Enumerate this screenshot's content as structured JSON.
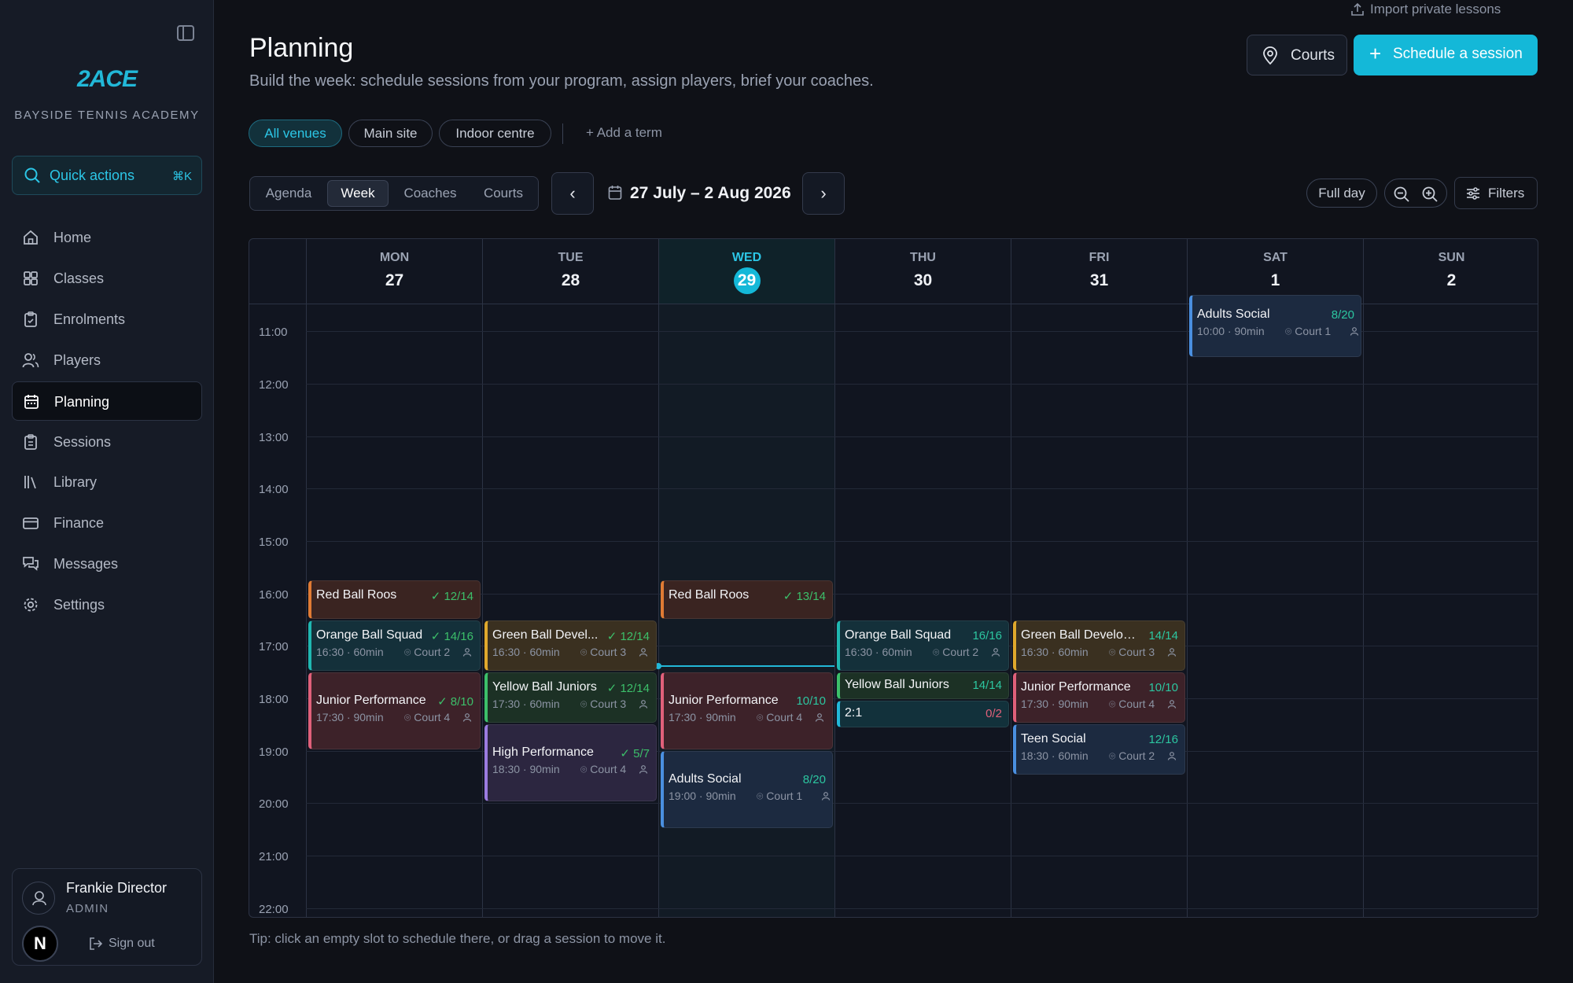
{
  "sidebar": {
    "logo": "2ACE",
    "academy": "BAYSIDE TENNIS ACADEMY",
    "quick_actions": {
      "label": "Quick actions",
      "shortcut": "⌘K"
    },
    "items": [
      {
        "label": "Home",
        "icon": "home-icon"
      },
      {
        "label": "Classes",
        "icon": "grid-icon"
      },
      {
        "label": "Enrolments",
        "icon": "clipboard-icon"
      },
      {
        "label": "Players",
        "icon": "users-icon"
      },
      {
        "label": "Planning",
        "icon": "calendar-icon",
        "active": true
      },
      {
        "label": "Sessions",
        "icon": "clipboard-list-icon"
      },
      {
        "label": "Library",
        "icon": "library-icon"
      },
      {
        "label": "Finance",
        "icon": "card-icon"
      },
      {
        "label": "Messages",
        "icon": "messages-icon"
      },
      {
        "label": "Settings",
        "icon": "gear-icon"
      }
    ],
    "user": {
      "name": "Frankie Director",
      "role": "ADMIN",
      "badge": "N",
      "signout": "Sign out"
    }
  },
  "header": {
    "import_label": "Import private lessons",
    "title": "Planning",
    "subtitle": "Build the week: schedule sessions from your program, assign players, brief your coaches.",
    "courts_label": "Courts",
    "schedule_label": "Schedule a session"
  },
  "venues": {
    "chips": [
      "All venues",
      "Main site",
      "Indoor centre"
    ],
    "active": "All venues",
    "add_term": "Add a term"
  },
  "toolbar": {
    "views": [
      "Agenda",
      "Week",
      "Coaches",
      "Courts"
    ],
    "active_view": "Week",
    "range": "27 July – 2 Aug 2026",
    "prev": "‹",
    "next": "›",
    "full_day": "Full day",
    "filters": "Filters"
  },
  "calendar": {
    "days": [
      {
        "name": "MON",
        "date": "27"
      },
      {
        "name": "TUE",
        "date": "28"
      },
      {
        "name": "WED",
        "date": "29",
        "today": true
      },
      {
        "name": "THU",
        "date": "30"
      },
      {
        "name": "FRI",
        "date": "31"
      },
      {
        "name": "SAT",
        "date": "1"
      },
      {
        "name": "SUN",
        "date": "2"
      }
    ],
    "hours": [
      "11:00",
      "12:00",
      "13:00",
      "14:00",
      "15:00",
      "16:00",
      "17:00",
      "18:00",
      "19:00",
      "20:00",
      "21:00",
      "22:00"
    ],
    "events": {
      "mon_red": {
        "title": "Red Ball Roos",
        "count": "✓ 12/14"
      },
      "mon_orange": {
        "title": "Orange Ball Squad",
        "count": "✓ 14/16",
        "meta": "16:30 · 60min",
        "court": "Court 2"
      },
      "mon_junior": {
        "title": "Junior Performance",
        "count": "✓ 8/10",
        "meta": "17:30 · 90min",
        "court": "Court 4"
      },
      "tue_green": {
        "title": "Green Ball Devel...",
        "count": "✓ 12/14",
        "meta": "16:30 · 60min",
        "court": "Court 3"
      },
      "tue_yellow": {
        "title": "Yellow Ball Juniors",
        "count": "✓ 12/14",
        "meta": "17:30 · 60min",
        "court": "Court 3"
      },
      "tue_high": {
        "title": "High Performance",
        "count": "✓ 5/7",
        "meta": "18:30 · 90min",
        "court": "Court 4"
      },
      "wed_red": {
        "title": "Red Ball Roos",
        "count": "✓ 13/14"
      },
      "wed_junior": {
        "title": "Junior Performance",
        "count": "10/10",
        "meta": "17:30 · 90min",
        "court": "Court 4"
      },
      "wed_adults": {
        "title": "Adults Social",
        "count": "8/20",
        "meta": "19:00 · 90min",
        "court": "Court 1"
      },
      "thu_orange": {
        "title": "Orange Ball Squad",
        "count": "16/16",
        "meta": "16:30 · 60min",
        "court": "Court 2"
      },
      "thu_yellow": {
        "title": "Yellow Ball Juniors",
        "count": "14/14"
      },
      "thu_21": {
        "title": "2:1",
        "count": "0/2"
      },
      "fri_green": {
        "title": "Green Ball Develop...",
        "count": "14/14",
        "meta": "16:30 · 60min",
        "court": "Court 3"
      },
      "fri_junior": {
        "title": "Junior Performance",
        "count": "10/10",
        "meta": "17:30 · 90min",
        "court": "Court 4"
      },
      "fri_teen": {
        "title": "Teen Social",
        "count": "12/16",
        "meta": "18:30 · 60min",
        "court": "Court 2"
      },
      "sat_adults": {
        "title": "Adults Social",
        "count": "8/20",
        "meta": "10:00 · 90min",
        "court": "Court 1"
      }
    }
  },
  "tip": "Tip: click an empty slot to schedule there, or drag a session to move it.",
  "colors": {
    "accent": "#14b8d8",
    "background": "#0f1117",
    "sidebar": "#161b26"
  }
}
